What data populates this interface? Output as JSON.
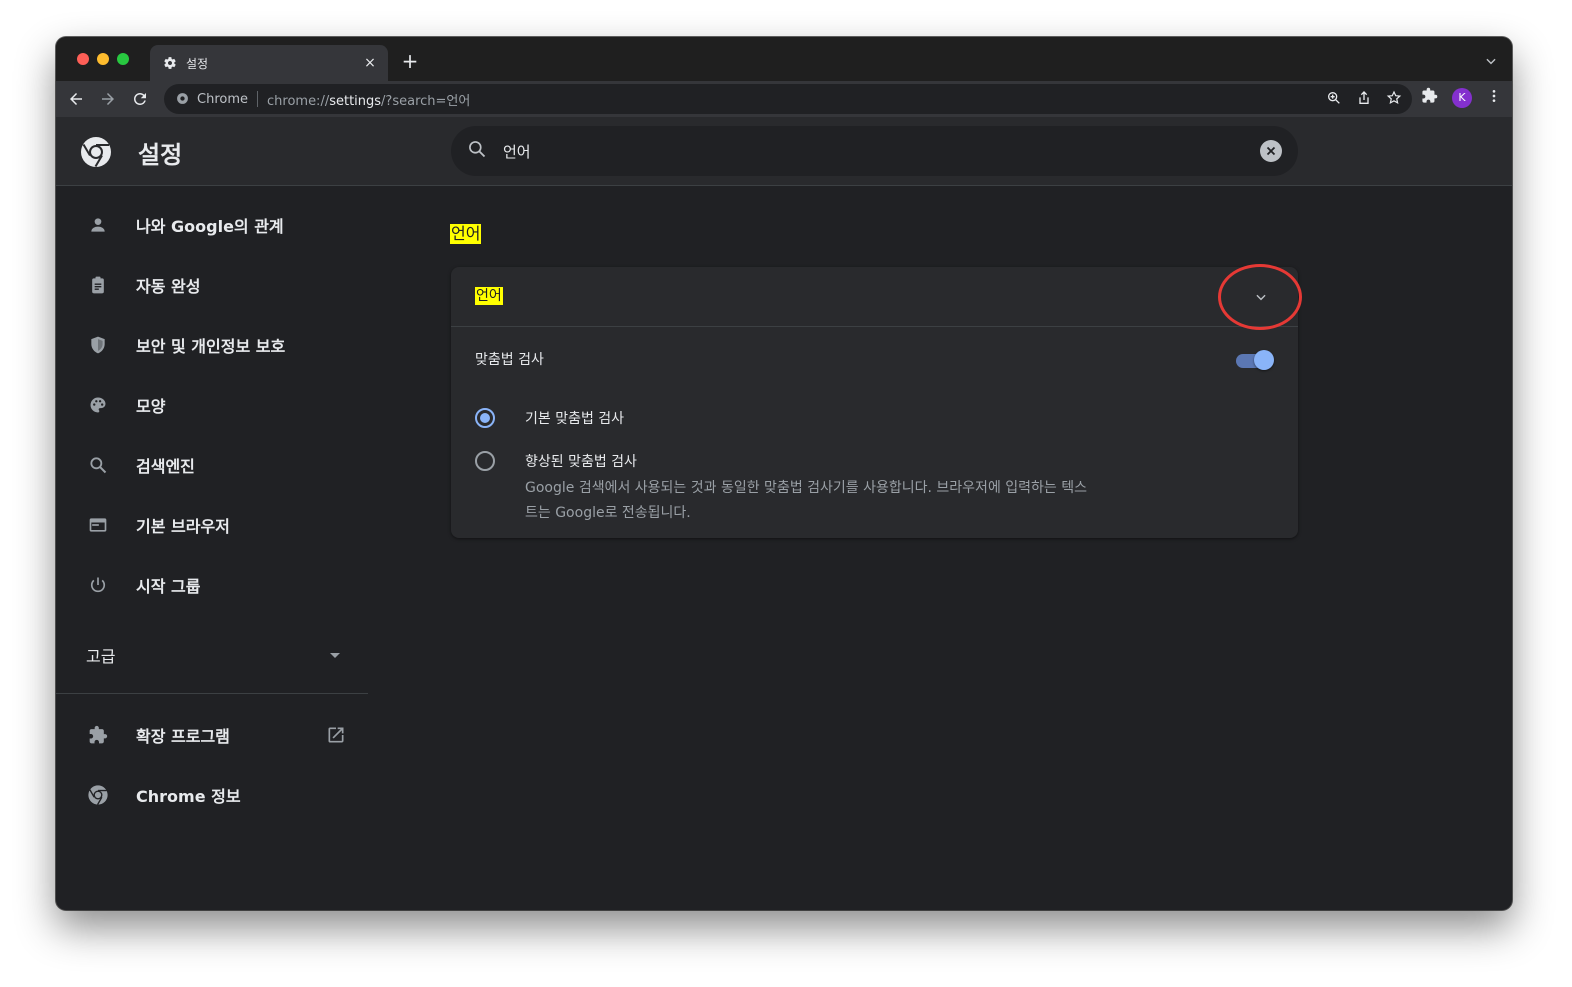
{
  "browser": {
    "tab_title": "설정",
    "tab_close": "×",
    "new_tab": "+",
    "omnibox_site": "Chrome",
    "url_prefix": "chrome://",
    "url_host": "settings",
    "url_suffix": "/?search=언어",
    "avatar_letter": "K"
  },
  "settings": {
    "title": "설정",
    "search_value": "언어"
  },
  "sidebar": {
    "items": [
      {
        "label": "나와 Google의 관계",
        "icon": "person-icon"
      },
      {
        "label": "자동 완성",
        "icon": "clipboard-icon"
      },
      {
        "label": "보안 및 개인정보 보호",
        "icon": "shield-icon"
      },
      {
        "label": "모양",
        "icon": "palette-icon"
      },
      {
        "label": "검색엔진",
        "icon": "search-icon"
      },
      {
        "label": "기본 브라우저",
        "icon": "browser-icon"
      },
      {
        "label": "시작 그룹",
        "icon": "power-icon"
      }
    ],
    "advanced": "고급",
    "extensions": "확장 프로그램",
    "about": "Chrome 정보"
  },
  "main": {
    "section_title": "언어",
    "languages_row": "언어",
    "spellcheck_label": "맞춤법 검사",
    "spellcheck_enabled": true,
    "basic_spellcheck": "기본 맞춤법 검사",
    "enhanced_spellcheck": "향상된 맞춤법 검사",
    "enhanced_desc": "Google 검색에서 사용되는 것과 동일한 맞춤법 검사기를 사용합니다. 브라우저에 입력하는 텍스트는 Google로 전송됩니다.",
    "selected_option": "basic"
  },
  "colors": {
    "background": "#202124",
    "card": "#292a2d",
    "accent": "#8ab4f8",
    "highlight": "#ffff00",
    "annotation": "#e53935"
  }
}
